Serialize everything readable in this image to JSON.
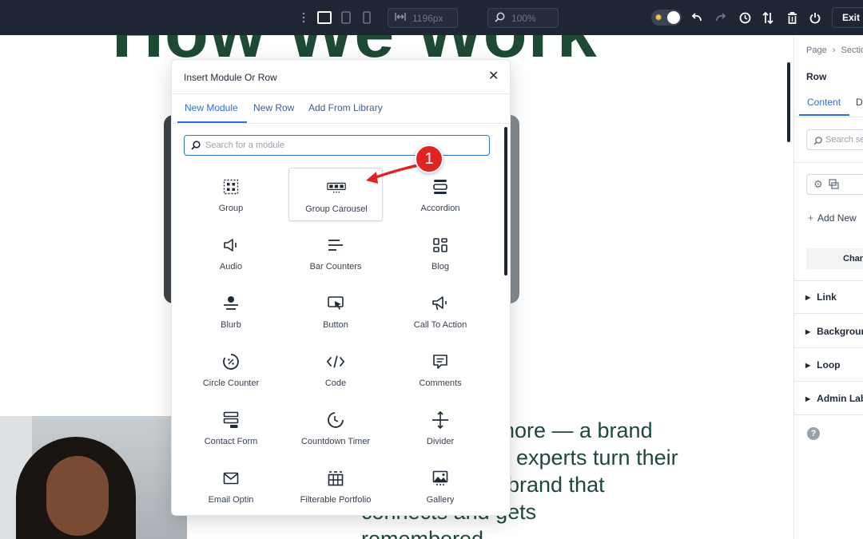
{
  "toolbar": {
    "width_value": "1196px",
    "zoom_value": "100%",
    "exit_label": "Exit",
    "icons": [
      "drag-handle-icon",
      "desktop-view-icon",
      "tablet-view-icon",
      "phone-view-icon",
      "width-icon",
      "zoom-icon",
      "theme-toggle-icon",
      "undo-icon",
      "redo-icon",
      "history-icon",
      "sort-icon",
      "trash-icon",
      "power-icon"
    ]
  },
  "canvas": {
    "heading": "How We Work",
    "body_lines": [
      "tmore — a brand",
      "experts turn their",
      "brand that",
      "connects and gets",
      "remembered"
    ]
  },
  "modal": {
    "title": "Insert Module Or Row",
    "tabs": [
      "New Module",
      "New Row",
      "Add From Library"
    ],
    "active_tab": "New Module",
    "search_placeholder": "Search for a module",
    "modules": [
      {
        "label": "Group",
        "icon": "group-icon"
      },
      {
        "label": "Group Carousel",
        "icon": "group-carousel-icon"
      },
      {
        "label": "Accordion",
        "icon": "accordion-icon"
      },
      {
        "label": "Audio",
        "icon": "audio-icon"
      },
      {
        "label": "Bar Counters",
        "icon": "bar-counters-icon"
      },
      {
        "label": "Blog",
        "icon": "blog-icon"
      },
      {
        "label": "Blurb",
        "icon": "blurb-icon"
      },
      {
        "label": "Button",
        "icon": "button-icon"
      },
      {
        "label": "Call To Action",
        "icon": "call-to-action-icon"
      },
      {
        "label": "Circle Counter",
        "icon": "circle-counter-icon"
      },
      {
        "label": "Code",
        "icon": "code-icon"
      },
      {
        "label": "Comments",
        "icon": "comments-icon"
      },
      {
        "label": "Contact Form",
        "icon": "contact-form-icon"
      },
      {
        "label": "Countdown Timer",
        "icon": "countdown-timer-icon"
      },
      {
        "label": "Divider",
        "icon": "divider-icon"
      },
      {
        "label": "Email Optin",
        "icon": "email-optin-icon"
      },
      {
        "label": "Filterable Portfolio",
        "icon": "filterable-portfolio-icon"
      },
      {
        "label": "Gallery",
        "icon": "gallery-icon"
      }
    ],
    "highlighted_module": "Group Carousel"
  },
  "right_panel": {
    "breadcrumb_page": "Page",
    "breadcrumb_section": "Section",
    "element_title": "Row",
    "tabs": [
      "Content",
      "Design"
    ],
    "search_placeholder": "Search settings",
    "add_new_label": "Add New",
    "change_label": "Change",
    "sections": [
      "Link",
      "Background",
      "Loop",
      "Admin Label"
    ]
  },
  "annotation": {
    "badge_number": "1",
    "color": "#e02424"
  },
  "colors": {
    "toolbar_bg": "#1e2533",
    "accent": "#2b6ee5",
    "heading_green": "#1d4a34"
  }
}
